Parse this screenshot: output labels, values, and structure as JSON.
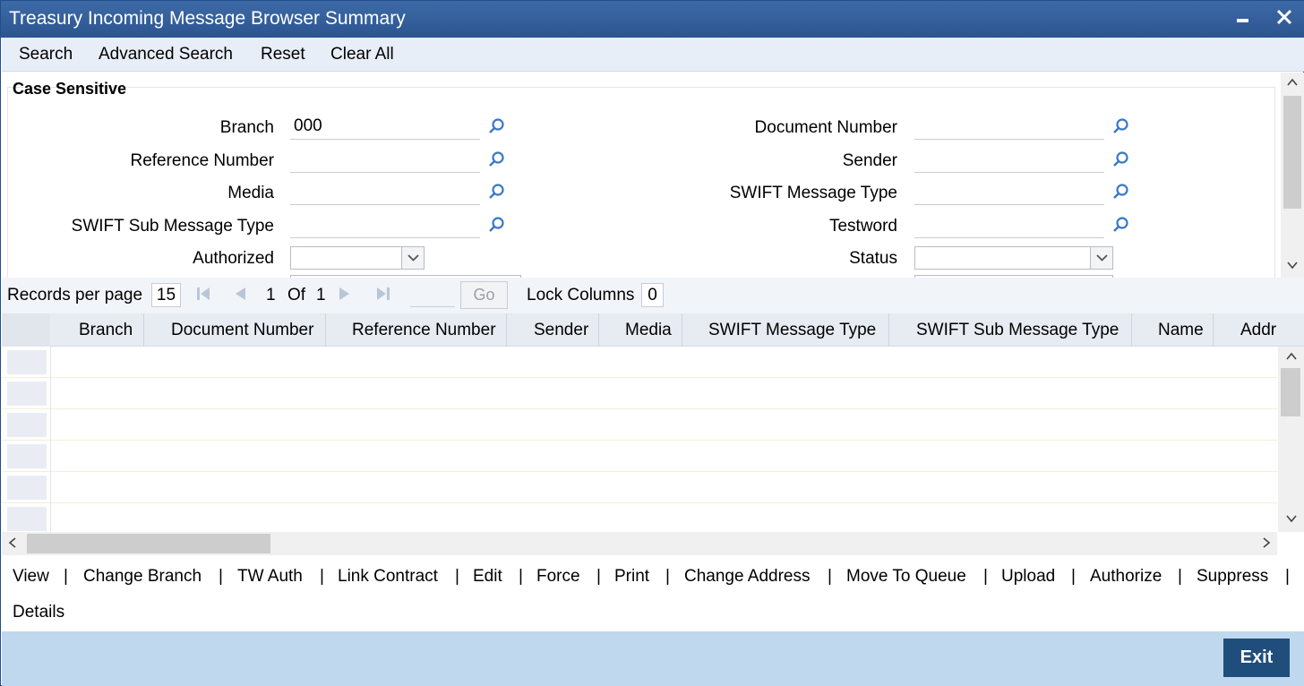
{
  "window": {
    "title": "Treasury Incoming Message Browser Summary",
    "minimize_icon": "minimize-icon",
    "close_icon": "close-icon"
  },
  "menu": {
    "search": "Search",
    "advanced_search": "Advanced Search",
    "reset": "Reset",
    "clear_all": "Clear All"
  },
  "criteria": {
    "section_title": "Case Sensitive",
    "branch_label": "Branch",
    "branch_value": "000",
    "reference_number_label": "Reference Number",
    "reference_number_value": "",
    "media_label": "Media",
    "media_value": "",
    "swift_sub_message_type_label": "SWIFT Sub Message Type",
    "swift_sub_message_type_value": "",
    "authorized_label": "Authorized",
    "authorized_value": "",
    "document_number_label": "Document Number",
    "document_number_value": "",
    "sender_label": "Sender",
    "sender_value": "",
    "swift_message_type_label": "SWIFT Message Type",
    "swift_message_type_value": "",
    "testword_label": "Testword",
    "testword_value": "",
    "status_label": "Status",
    "status_value": ""
  },
  "pager": {
    "records_per_page_label": "Records per page",
    "records_per_page": "15",
    "current_page": "1",
    "of_label": "Of",
    "total_pages": "1",
    "go_label": "Go",
    "lock_columns_label": "Lock Columns",
    "lock_columns_value": "0"
  },
  "grid": {
    "columns": [
      "Branch",
      "Document Number",
      "Reference Number",
      "Sender",
      "Media",
      "SWIFT Message Type",
      "SWIFT Sub Message Type",
      "Name",
      "Addr"
    ],
    "rows": [
      "",
      "",
      "",
      "",
      "",
      ""
    ]
  },
  "actions": {
    "view": "View",
    "change_branch": "Change Branch",
    "tw_auth": "TW Auth",
    "link_contract": "Link Contract",
    "edit": "Edit",
    "force": "Force",
    "print": "Print",
    "change_address": "Change Address",
    "move_to_queue": "Move To Queue",
    "upload": "Upload",
    "authorize": "Authorize",
    "suppress": "Suppress",
    "details": "Details",
    "separator": "|"
  },
  "footer": {
    "exit_label": "Exit"
  },
  "colors": {
    "title_bar": "#2c5590",
    "footer": "#bfd8ee",
    "exit_button": "#1f4e7c",
    "lookup_icon": "#3a78c4"
  }
}
